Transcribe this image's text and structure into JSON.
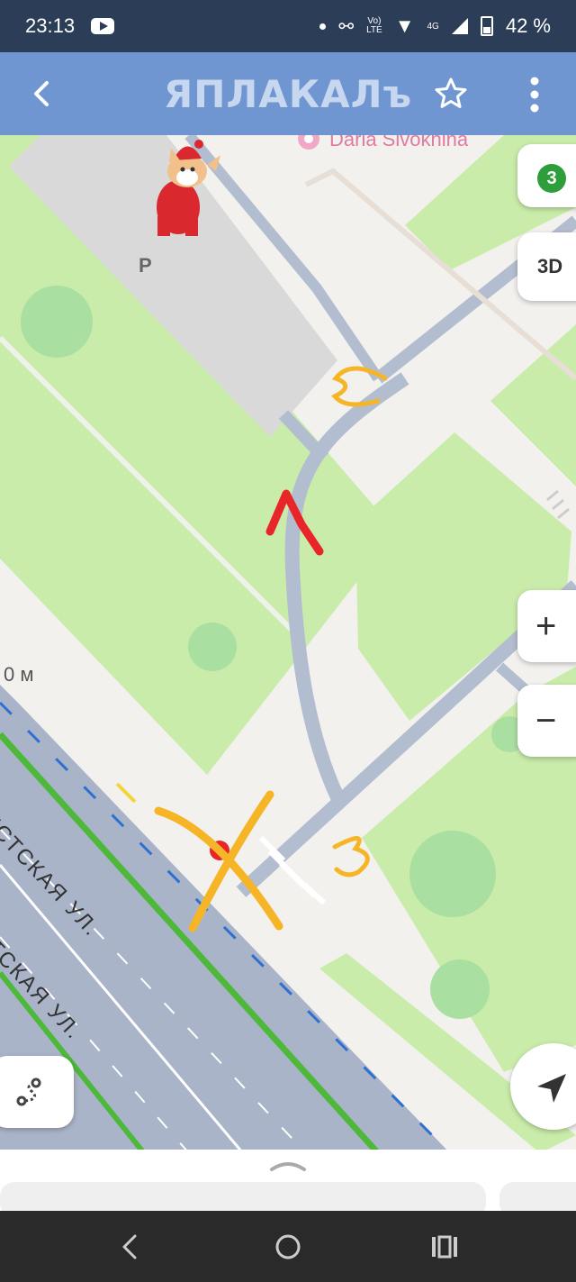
{
  "status": {
    "time": "23:13",
    "battery": "42 %",
    "net": "4G"
  },
  "header": {
    "title": "ЯПЛАКАЛъ"
  },
  "map": {
    "poi_label": "Daria Sivokhina",
    "parking_label": "P",
    "scale_label": "0 м",
    "street_label_1": "ИСТСКАЯ УЛ.",
    "street_label_2": "ТСКАЯ УЛ.",
    "annotation_1": "1",
    "annotation_3": "3",
    "annotation_3_mirror": "3",
    "annotation_x": "X"
  },
  "controls": {
    "layers_count": "3",
    "threed_label": "3D",
    "zoom_in": "+",
    "zoom_out": "−"
  },
  "colors": {
    "statusbar": "#2c3e57",
    "appbar": "#7096d1",
    "park": "#c9ecaa",
    "road": "#aab4c8",
    "path": "#b3bdd0",
    "highway_line": "#4db83a",
    "annotation_red": "#e8262a",
    "annotation_yellow": "#f5b526"
  }
}
